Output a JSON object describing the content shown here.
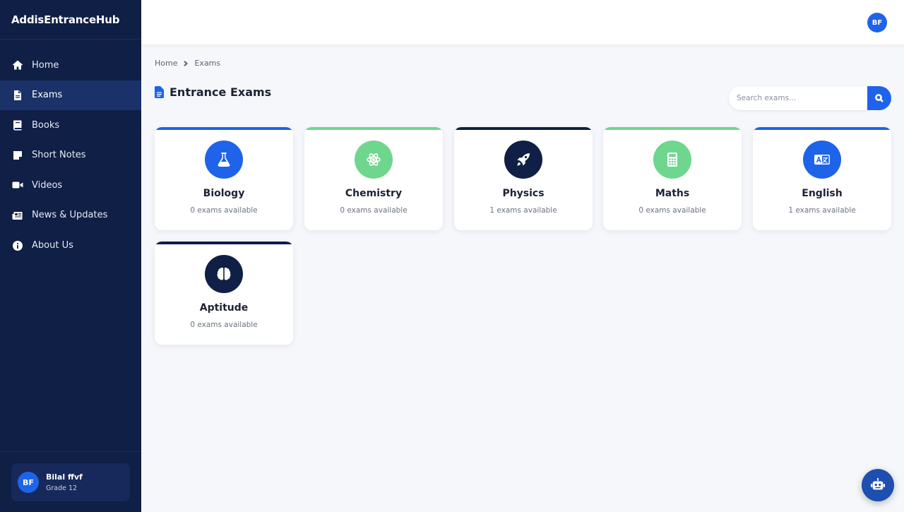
{
  "brand": "AddisEntranceHub",
  "nav": [
    {
      "label": "Home",
      "icon": "home-icon"
    },
    {
      "label": "Exams",
      "icon": "document-icon",
      "active": true
    },
    {
      "label": "Books",
      "icon": "book-icon"
    },
    {
      "label": "Short Notes",
      "icon": "note-icon"
    },
    {
      "label": "Videos",
      "icon": "video-icon"
    },
    {
      "label": "News & Updates",
      "icon": "newspaper-icon"
    },
    {
      "label": "About Us",
      "icon": "info-icon"
    }
  ],
  "user": {
    "initials": "BF",
    "name": "Bilal ffvf",
    "grade": "Grade 12"
  },
  "topbar": {
    "avatar_initials": "BF"
  },
  "breadcrumb": {
    "home": "Home",
    "current": "Exams"
  },
  "page_title": "Entrance Exams",
  "search": {
    "placeholder": "Search exams..."
  },
  "subjects": [
    {
      "name": "Biology",
      "count": "0 exams available",
      "icon": "flask-icon",
      "color": "#1e63e9"
    },
    {
      "name": "Chemistry",
      "count": "0 exams available",
      "icon": "atom-icon",
      "color": "#6fd68e"
    },
    {
      "name": "Physics",
      "count": "1 exams available",
      "icon": "rocket-icon",
      "color": "#0f1f45"
    },
    {
      "name": "Maths",
      "count": "0 exams available",
      "icon": "calculator-icon",
      "color": "#6fd68e"
    },
    {
      "name": "English",
      "count": "1 exams available",
      "icon": "language-icon",
      "color": "#1e63e9"
    },
    {
      "name": "Aptitude",
      "count": "0 exams available",
      "icon": "brain-icon",
      "color": "#0f1f45"
    }
  ],
  "colors": {
    "sidebar": "#0f1f45",
    "active_nav": "#1a3169",
    "accent": "#1e63e9",
    "green": "#6fd68e",
    "background": "#f5f7fb"
  }
}
